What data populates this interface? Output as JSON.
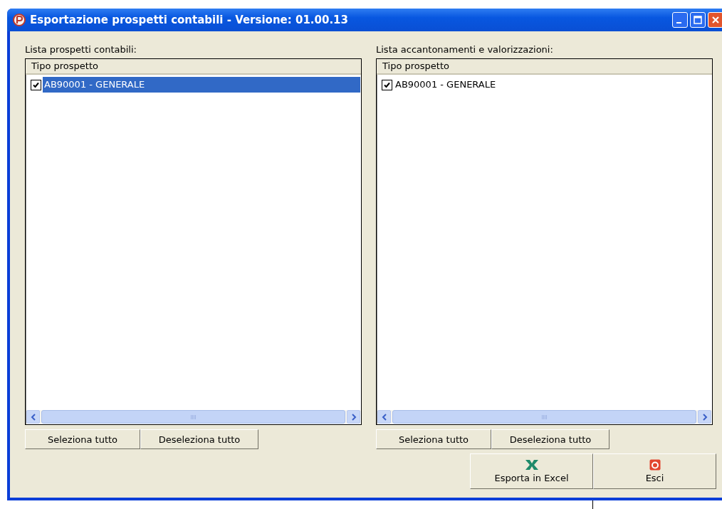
{
  "window": {
    "title": "Esportazione prospetti contabili - Versione: 01.00.13"
  },
  "panels": [
    {
      "label": "Lista prospetti contabili:",
      "column": "Tipo prospetto",
      "rows": [
        {
          "label": "AB90001 - GENERALE",
          "checked": true,
          "selected": true
        }
      ],
      "buttons": [
        "Seleziona tutto",
        "Deseleziona tutto"
      ]
    },
    {
      "label": "Lista accantonamenti e valorizzazioni:",
      "column": "Tipo prospetto",
      "rows": [
        {
          "label": "AB90001 - GENERALE",
          "checked": true,
          "selected": false
        }
      ],
      "buttons": [
        "Seleziona tutto",
        "Deseleziona tutto"
      ]
    }
  ],
  "actions": [
    {
      "kind": "excel",
      "label": "Esporta in Excel"
    },
    {
      "kind": "exit",
      "label": "Esci"
    }
  ]
}
